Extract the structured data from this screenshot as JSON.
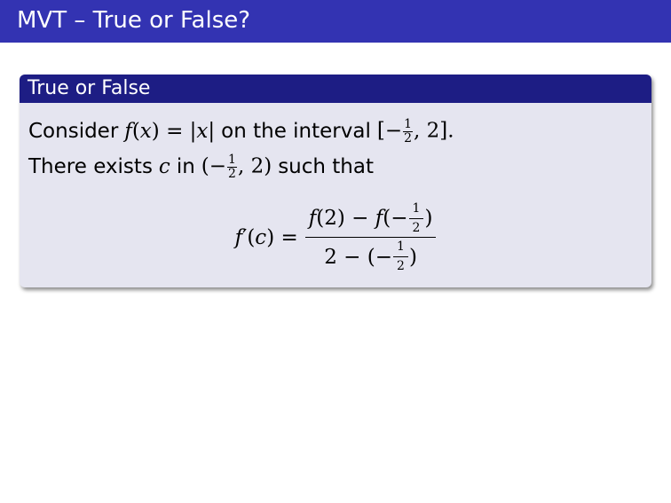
{
  "slide": {
    "title": "MVT – True or False?"
  },
  "block": {
    "title": "True or False",
    "line1": {
      "t1": "Consider",
      "t2": "on the interval"
    },
    "line2": {
      "t1": "There exists",
      "t2": "in",
      "t3": "such that"
    }
  },
  "colors": {
    "title_bar": "#3333b2",
    "block_header": "#1d1d84",
    "block_body": "#e5e5f0"
  }
}
